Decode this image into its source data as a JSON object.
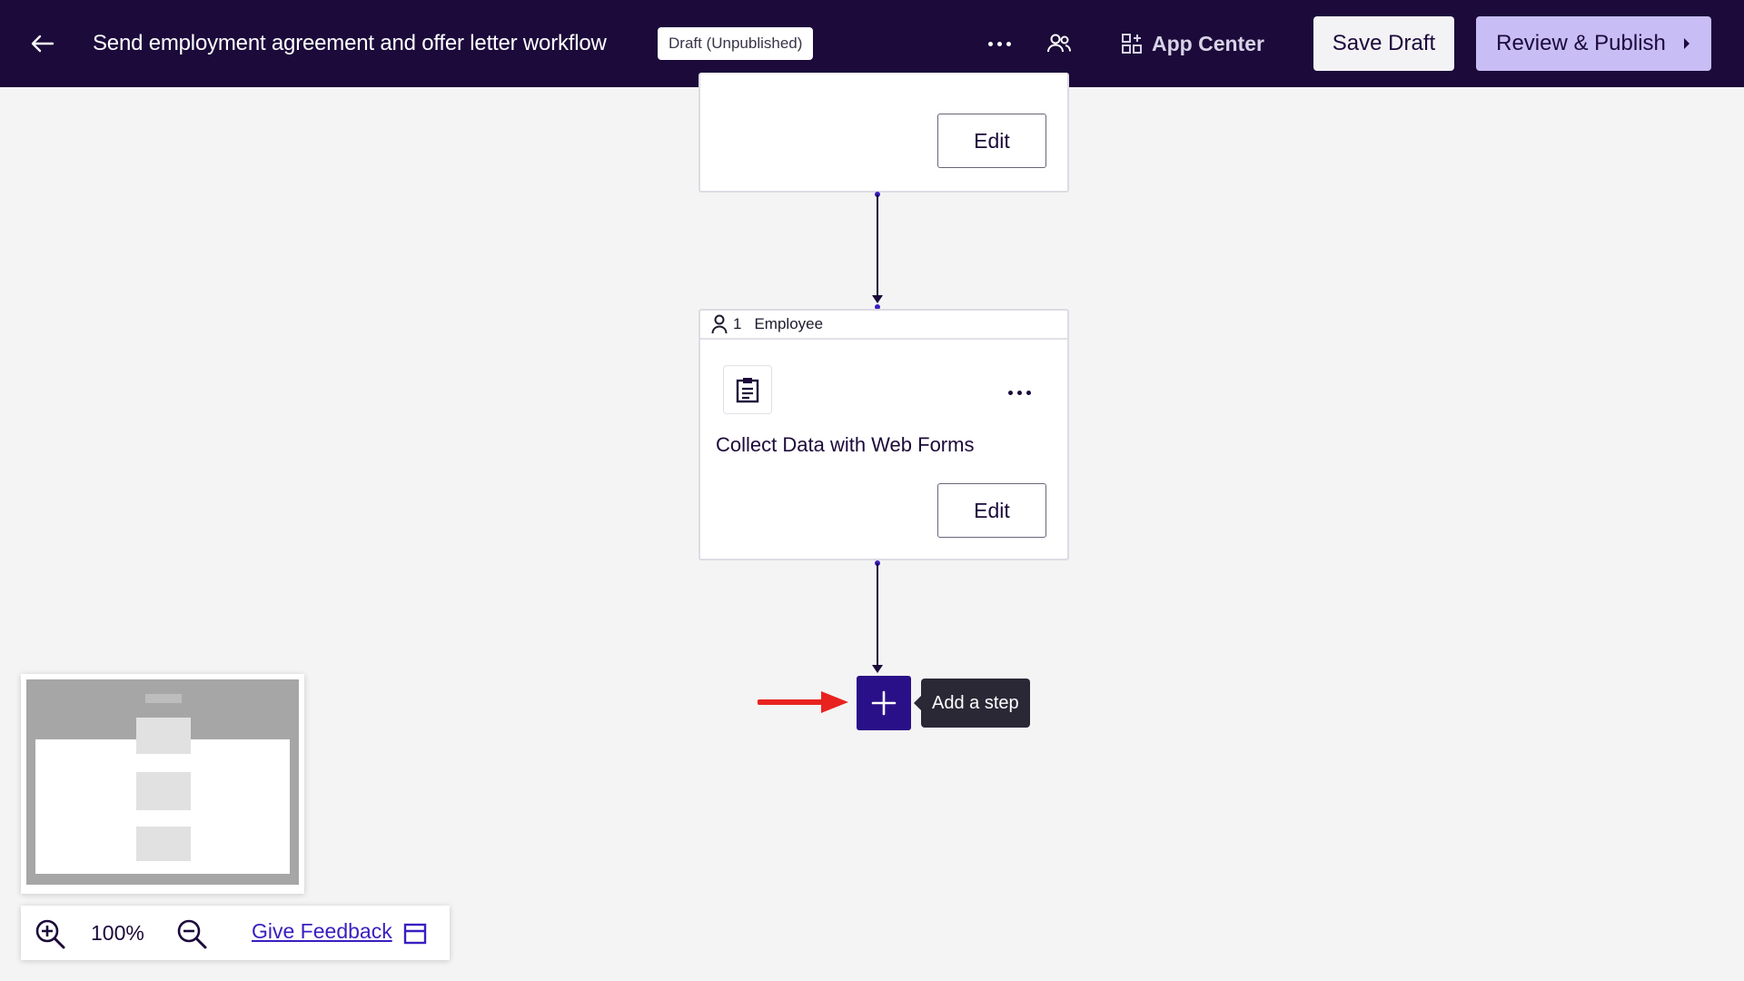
{
  "header": {
    "title": "Send employment agreement and offer letter workflow",
    "status_badge": "Draft (Unpublished)",
    "app_center_label": "App Center",
    "save_draft_label": "Save Draft",
    "review_publish_label": "Review & Publish"
  },
  "canvas": {
    "top_card": {
      "edit_label": "Edit"
    },
    "step_card": {
      "assignee_count": "1",
      "assignee_role": "Employee",
      "title": "Collect Data with Web Forms",
      "edit_label": "Edit"
    },
    "add_step_tooltip": "Add a step"
  },
  "zoom": {
    "level": "100%",
    "feedback_label": "Give Feedback"
  },
  "colors": {
    "header_bg": "#1b0a3a",
    "primary": "#2a1088",
    "publish_btn": "#c8bdf5",
    "link": "#3a1ec0",
    "annotation_arrow": "#e8231f"
  },
  "icons": {
    "back": "arrow-left-icon",
    "more": "more-horizontal-icon",
    "collaborators": "people-icon",
    "app_center": "apps-grid-icon",
    "publish_chevron": "caret-right-icon",
    "assignee": "person-icon",
    "step_type": "clipboard-icon",
    "add": "plus-icon",
    "zoom_in": "zoom-in-icon",
    "zoom_out": "zoom-out-icon",
    "feedback": "panel-icon"
  }
}
